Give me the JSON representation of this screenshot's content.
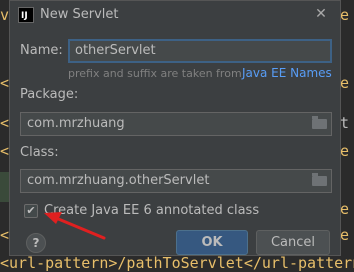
{
  "dialog": {
    "title": "New Servlet",
    "app_icon_text": "IJ",
    "name_label": "Name:",
    "name_value": "otherServlet",
    "hint_text": "prefix and suffix are taken from",
    "hint_link": "Java EE Names",
    "package_label": "Package:",
    "package_value": "com.mrzhuang",
    "class_label": "Class:",
    "class_value": "com.mrzhuang.otherServlet",
    "checkbox_label": "Create Java EE 6 annotated class",
    "checkbox_checked": true,
    "checkbox_mark": "✔",
    "help_label": "?",
    "ok_label": "OK",
    "cancel_label": "Cancel"
  },
  "background_editor": {
    "bottom_line": "<url-pattern>/pathToServlet</url-pattern>"
  },
  "colors": {
    "annotation_arrow": "#e02020",
    "link": "#589df6",
    "ok_button": "#365880"
  }
}
